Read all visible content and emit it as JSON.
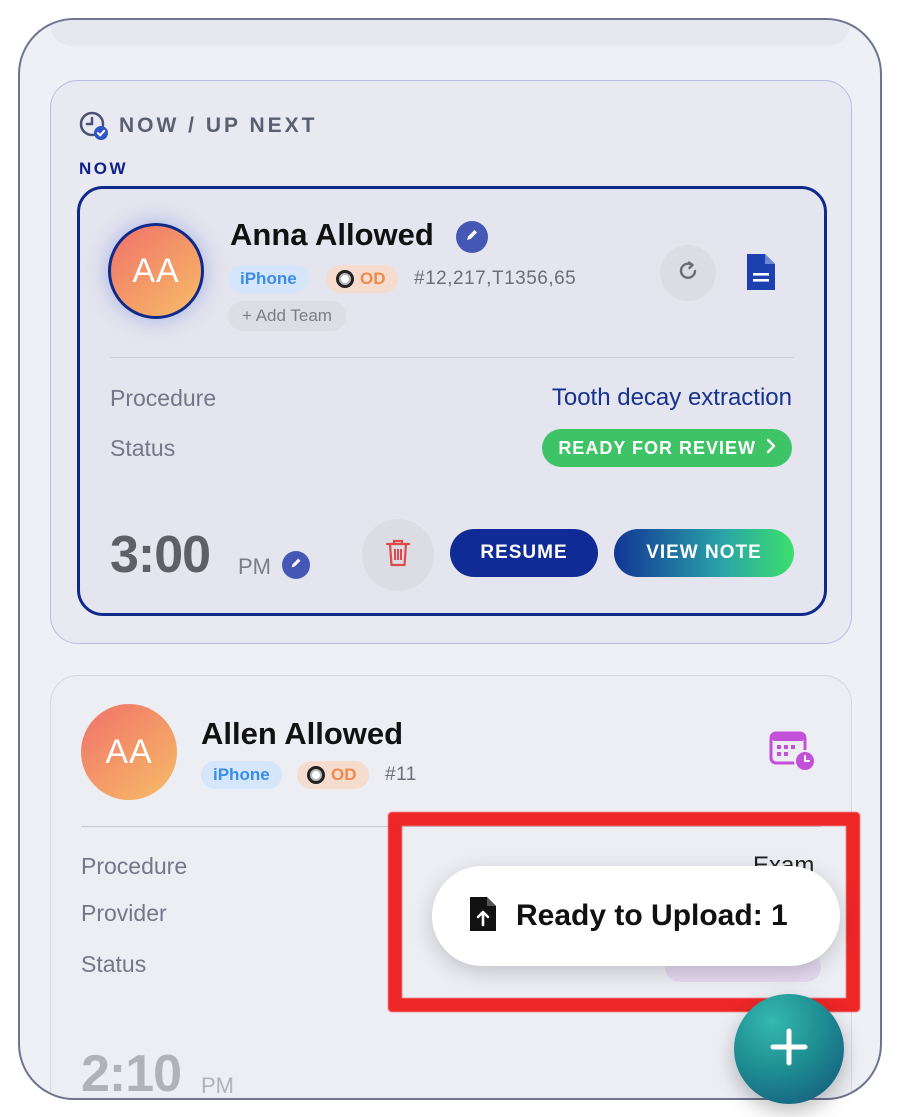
{
  "section": {
    "title": "NOW / UP NEXT",
    "now_label": "NOW"
  },
  "current": {
    "initials": "AA",
    "name": "Anna Allowed",
    "device": "iPhone",
    "od_label": "OD",
    "teeth": "#12,217,T1356,65",
    "add_team": "+ Add Team",
    "procedure_label": "Procedure",
    "procedure_value": "Tooth decay extraction",
    "status_label": "Status",
    "status_value": "READY FOR REVIEW",
    "time": "3:00",
    "ampm": "PM",
    "resume_label": "RESUME",
    "view_note_label": "VIEW NOTE"
  },
  "next": {
    "initials": "AA",
    "name": "Allen Allowed",
    "device": "iPhone",
    "od_label": "OD",
    "teeth": "#11",
    "procedure_label": "Procedure",
    "procedure_value": "Exam",
    "provider_label": "Provider",
    "status_label": "Status",
    "time": "2:10",
    "ampm": "PM"
  },
  "toast": {
    "text": "Ready to Upload: 1"
  },
  "colors": {
    "brand_navy": "#102a96",
    "status_green": "#3ec466",
    "annotation_red": "#ee1c1c",
    "calendar_purple": "#c44fd8"
  },
  "icons": [
    "clock-check-icon",
    "pencil-icon",
    "refresh-icon",
    "document-icon",
    "trash-icon",
    "chevron-right-icon",
    "calendar-clock-icon",
    "file-upload-icon",
    "plus-icon"
  ]
}
